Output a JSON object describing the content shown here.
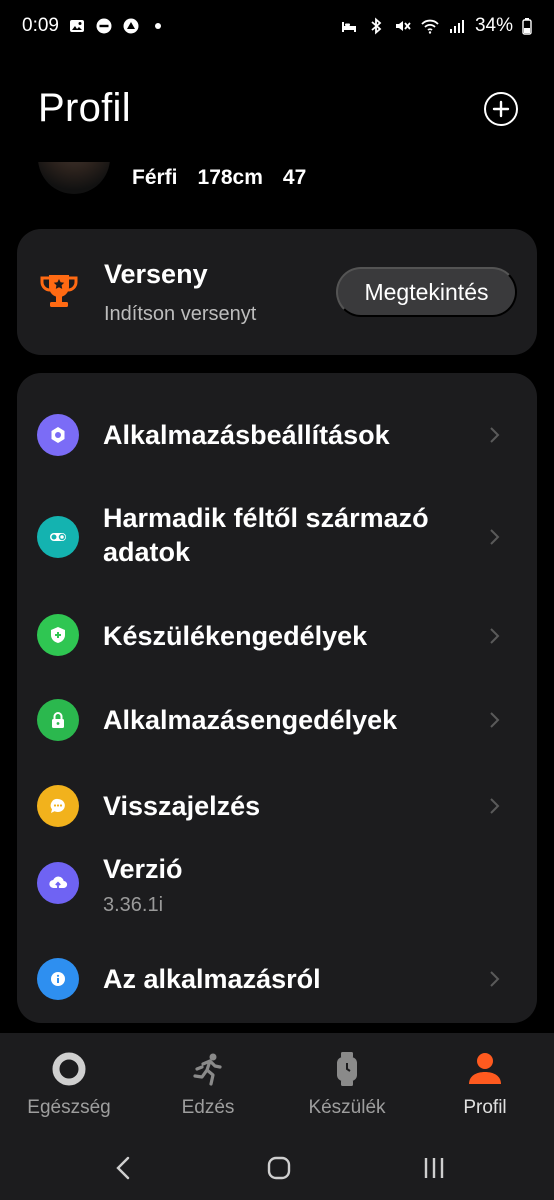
{
  "status_bar": {
    "time": "0:09",
    "battery": "34%",
    "left_icons": [
      "gallery-icon",
      "do-not-disturb-icon",
      "app-notification-icon",
      "dot-icon"
    ],
    "right_icons": [
      "bed-icon",
      "bluetooth-icon",
      "mute-icon",
      "wifi-icon",
      "signal-icon",
      "battery-icon"
    ]
  },
  "header": {
    "title": "Profil",
    "add_icon": "plus-circle-icon"
  },
  "profile": {
    "gender": "Férfi",
    "height": "178cm",
    "age": "47"
  },
  "contest": {
    "title": "Verseny",
    "subtitle": "Indítson versenyt",
    "button_label": "Megtekintés",
    "icon": "trophy-icon",
    "icon_color": "#ff6a13"
  },
  "settings": {
    "items": [
      {
        "label": "Alkalmazásbeállítások",
        "icon": "settings-icon",
        "color": "#7b6cf6",
        "chevron": true
      },
      {
        "label_line1": "Harmadik féltől származó",
        "label_line2": "adatok",
        "icon": "link-icon",
        "color": "#14b3b0",
        "chevron": true
      },
      {
        "label": "Készülékengedélyek",
        "icon": "shield-plus-icon",
        "color": "#2fc652",
        "chevron": true
      },
      {
        "label": "Alkalmazásengedélyek",
        "icon": "lock-icon",
        "color": "#2bb84e",
        "chevron": true
      },
      {
        "label": "Visszajelzés",
        "icon": "feedback-icon",
        "color": "#f2b21c",
        "chevron": true
      },
      {
        "label": "Verzió",
        "sub": "3.36.1i",
        "icon": "cloud-upload-icon",
        "color": "#6f63f3",
        "chevron": false
      },
      {
        "label": "Az alkalmazásról",
        "icon": "info-icon",
        "color": "#2e8ff0",
        "chevron": true
      }
    ]
  },
  "bottom_nav": {
    "items": [
      {
        "label": "Egészség",
        "icon": "ring-icon",
        "active": false
      },
      {
        "label": "Edzés",
        "icon": "running-icon",
        "active": false
      },
      {
        "label": "Készülék",
        "icon": "watch-icon",
        "active": false
      },
      {
        "label": "Profil",
        "icon": "person-icon",
        "active": true
      }
    ],
    "active_color": "#ff5a1f"
  }
}
